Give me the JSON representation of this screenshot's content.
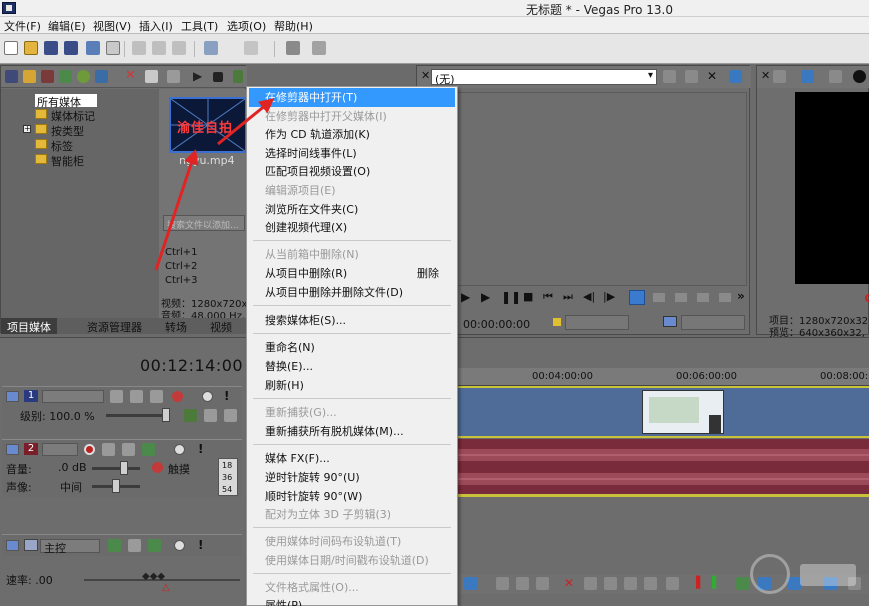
{
  "window": {
    "title": "无标题 * - Vegas Pro 13.0"
  },
  "menubar": {
    "items": [
      "文件(F)",
      "编辑(E)",
      "视图(V)",
      "插入(I)",
      "工具(T)",
      "选项(O)",
      "帮助(H)"
    ]
  },
  "media_tree": {
    "items": [
      "所有媒体",
      "媒体标记",
      "按类型",
      "标签",
      "智能柜"
    ]
  },
  "media_file": {
    "thumbnail_text": "渝佳自拍",
    "name": "ngyu.mp4"
  },
  "search": {
    "placeholder": "搜索文件以添加..."
  },
  "shortcuts": [
    "Ctrl+1",
    "Ctrl+2",
    "Ctrl+3"
  ],
  "media_info": {
    "video": "视频：1280x720x1",
    "audio": "音频：48,000 Hz,"
  },
  "bottom_tabs": [
    "项目媒体",
    "资源管理器",
    "转场",
    "视频 FX"
  ],
  "preview_left": {
    "dropdown_value": "(无)",
    "timecode": "00:00:00:00"
  },
  "preview_right": {
    "project": "项目：1280x720x32, 2",
    "preview": "预览：640x360x32, 15"
  },
  "timeline": {
    "current_time": "00:12:14:00",
    "ruler": [
      "00:04:00:00",
      "00:06:00:00",
      "00:08:00:00"
    ]
  },
  "tracks": {
    "video": {
      "number": "1",
      "level_label": "级别: 100.0 %"
    },
    "audio": {
      "number": "2",
      "volume_label": "音量:",
      "volume_value": ".0 dB",
      "pan_label": "声像:",
      "pan_value": "中间",
      "touch_label": "触摸",
      "meter_values": [
        "18",
        "36",
        "54"
      ]
    },
    "master": {
      "label": "主控"
    }
  },
  "rate": {
    "label": "速率: .00"
  },
  "context_menu": {
    "items": [
      {
        "label": "在修剪器中打开(T)",
        "state": "highlight"
      },
      {
        "label": "在修剪器中打开父媒体(I)",
        "state": "disabled"
      },
      {
        "label": "作为 CD 轨道添加(K)",
        "state": "enabled"
      },
      {
        "label": "选择时间线事件(L)",
        "state": "enabled"
      },
      {
        "label": "匹配项目视频设置(O)",
        "state": "enabled"
      },
      {
        "label": "编辑源项目(E)",
        "state": "disabled"
      },
      {
        "label": "浏览所在文件夹(C)",
        "state": "enabled"
      },
      {
        "label": "创建视频代理(X)",
        "state": "enabled"
      },
      {
        "label": "从当前箱中删除(N)",
        "state": "disabled"
      },
      {
        "label": "从项目中删除(R)",
        "state": "enabled",
        "shortcut": "删除"
      },
      {
        "label": "从项目中删除并删除文件(D)",
        "state": "enabled"
      },
      {
        "label": "搜索媒体柜(S)...",
        "state": "enabled"
      },
      {
        "label": "重命名(N)",
        "state": "enabled"
      },
      {
        "label": "替换(E)...",
        "state": "enabled"
      },
      {
        "label": "刷新(H)",
        "state": "enabled"
      },
      {
        "label": "重新捕获(G)...",
        "state": "disabled"
      },
      {
        "label": "重新捕获所有脱机媒体(M)...",
        "state": "enabled"
      },
      {
        "label": "媒体 FX(F)...",
        "state": "enabled"
      },
      {
        "label": "逆时针旋转 90°(U)",
        "state": "enabled"
      },
      {
        "label": "顺时针旋转 90°(W)",
        "state": "enabled"
      },
      {
        "label": "配对为立体 3D 子剪辑(3)",
        "state": "disabled"
      },
      {
        "label": "使用媒体时间码布设轨道(T)",
        "state": "disabled"
      },
      {
        "label": "使用媒体日期/时间戳布设轨道(D)",
        "state": "disabled"
      },
      {
        "label": "文件格式属性(O)...",
        "state": "disabled"
      },
      {
        "label": "属性(P)...",
        "state": "enabled"
      }
    ]
  },
  "colors": {
    "menu_highlight": "#3399ff",
    "arrow": "#e02424",
    "video_clip": "#4f6b97",
    "audio_clip": "#7a2b3b"
  }
}
